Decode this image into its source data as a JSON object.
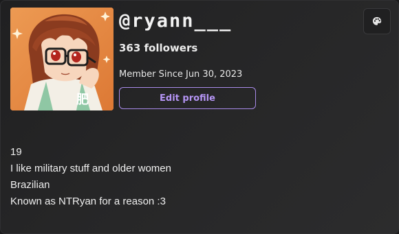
{
  "profile": {
    "username": "@ryann___",
    "followers": "363 followers",
    "member_since": "Member Since Jun 30, 2023",
    "edit_label": "Edit profile"
  },
  "bio": {
    "lines": [
      "19",
      "I like military stuff and older women",
      "Brazilian",
      "Known as NTRyan for a reason :3"
    ]
  },
  "icons": {
    "theme_button": "palette-icon",
    "avatar": "anime-character-with-glasses"
  },
  "colors": {
    "accent": "#b595f5",
    "background": "#262627",
    "text": "#f0f0f0"
  }
}
